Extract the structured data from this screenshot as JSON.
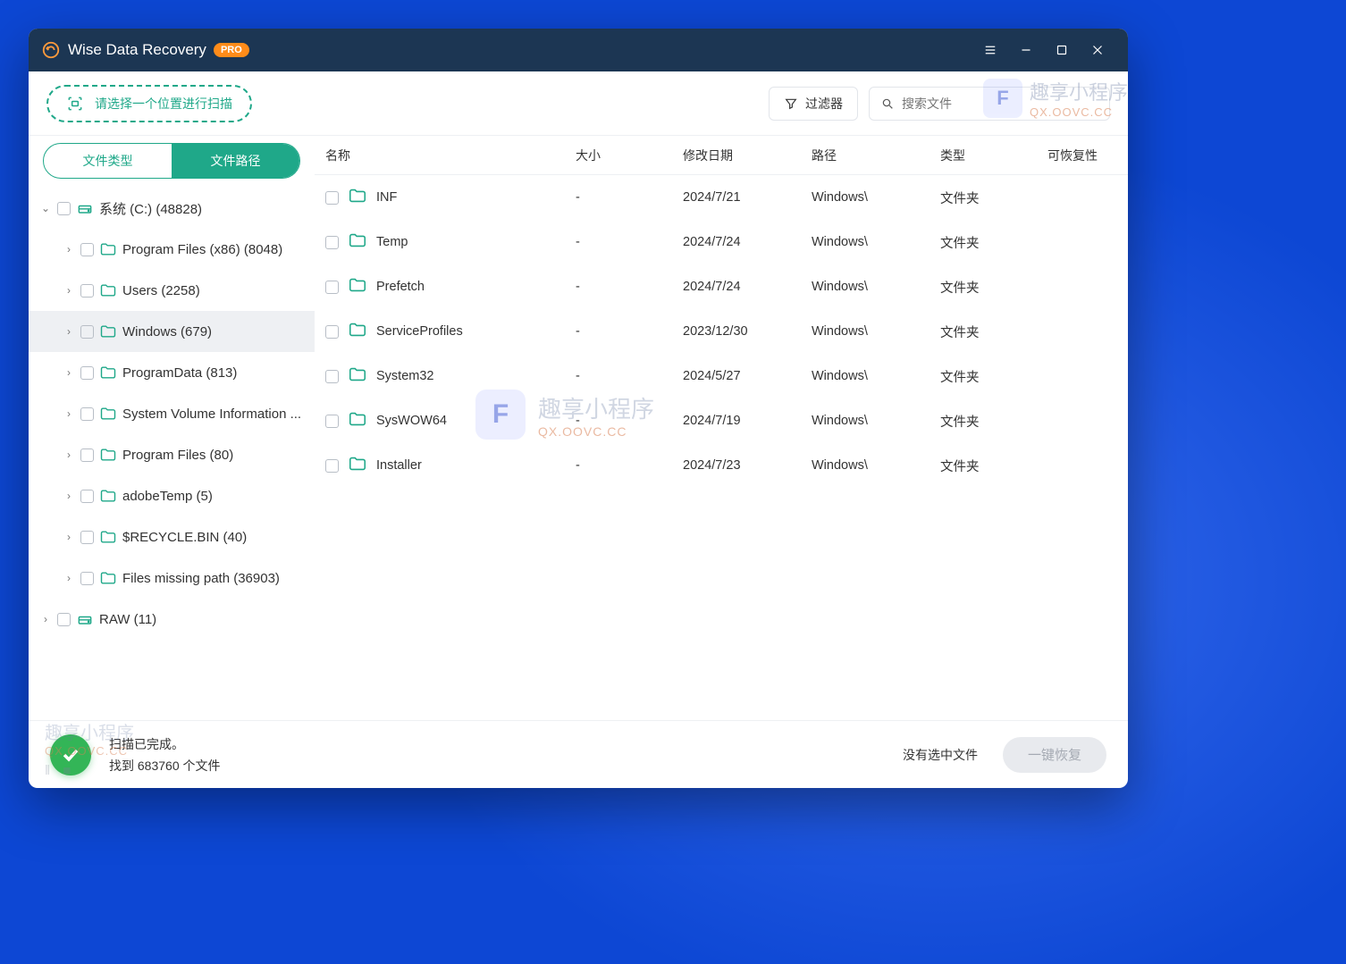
{
  "app": {
    "title": "Wise Data Recovery",
    "badge": "PRO"
  },
  "toolbar": {
    "scan_hint": "请选择一个位置进行扫描",
    "filter_label": "过滤器",
    "search_placeholder": "搜索文件"
  },
  "tabs": {
    "file_type": "文件类型",
    "file_path": "文件路径"
  },
  "tree": [
    {
      "label": "系统 (C:) (48828)",
      "depth": 0,
      "icon": "drive",
      "expanded": true
    },
    {
      "label": "Program Files (x86) (8048)",
      "depth": 1,
      "icon": "folder",
      "expanded": false
    },
    {
      "label": "Users (2258)",
      "depth": 1,
      "icon": "folder",
      "expanded": false
    },
    {
      "label": "Windows (679)",
      "depth": 1,
      "icon": "folder",
      "expanded": false,
      "selected": true
    },
    {
      "label": "ProgramData (813)",
      "depth": 1,
      "icon": "folder",
      "expanded": false
    },
    {
      "label": "System Volume Information ...",
      "depth": 1,
      "icon": "folder",
      "expanded": false
    },
    {
      "label": "Program Files (80)",
      "depth": 1,
      "icon": "folder",
      "expanded": false
    },
    {
      "label": "adobeTemp (5)",
      "depth": 1,
      "icon": "folder",
      "expanded": false
    },
    {
      "label": "$RECYCLE.BIN (40)",
      "depth": 1,
      "icon": "folder",
      "expanded": false
    },
    {
      "label": "Files missing path (36903)",
      "depth": 1,
      "icon": "folder",
      "expanded": false
    },
    {
      "label": "RAW (11)",
      "depth": 0,
      "icon": "drive",
      "expanded": false
    }
  ],
  "columns": {
    "name": "名称",
    "size": "大小",
    "date": "修改日期",
    "path": "路径",
    "type": "类型",
    "recoverability": "可恢复性"
  },
  "rows": [
    {
      "name": "INF",
      "size": "-",
      "date": "2024/7/21",
      "path": "Windows\\",
      "type": "文件夹"
    },
    {
      "name": "Temp",
      "size": "-",
      "date": "2024/7/24",
      "path": "Windows\\",
      "type": "文件夹"
    },
    {
      "name": "Prefetch",
      "size": "-",
      "date": "2024/7/24",
      "path": "Windows\\",
      "type": "文件夹"
    },
    {
      "name": "ServiceProfiles",
      "size": "-",
      "date": "2023/12/30",
      "path": "Windows\\",
      "type": "文件夹"
    },
    {
      "name": "System32",
      "size": "-",
      "date": "2024/5/27",
      "path": "Windows\\",
      "type": "文件夹"
    },
    {
      "name": "SysWOW64",
      "size": "-",
      "date": "2024/7/19",
      "path": "Windows\\",
      "type": "文件夹"
    },
    {
      "name": "Installer",
      "size": "-",
      "date": "2024/7/23",
      "path": "Windows\\",
      "type": "文件夹"
    }
  ],
  "status": {
    "line1": "扫描已完成。",
    "line2": "找到 683760 个文件",
    "no_selection": "没有选中文件",
    "recover_btn": "一键恢复"
  },
  "watermark": {
    "text": "趣享小程序",
    "url": "QX.OOVC.CC"
  }
}
